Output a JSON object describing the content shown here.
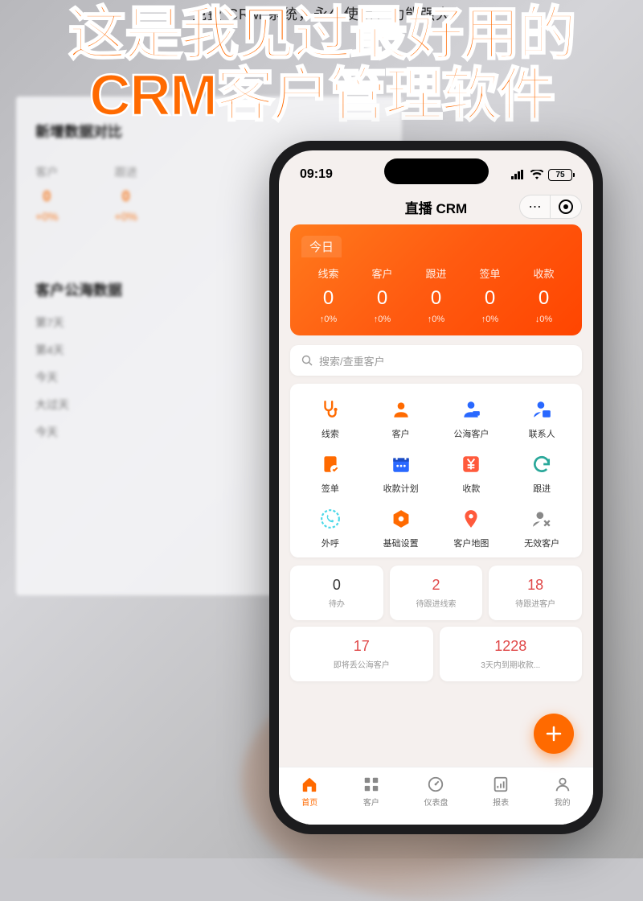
{
  "top_banner": "免费 CRM 系统，永久使用，功能强大",
  "headline_line1": "这是我见过最好用的",
  "headline_line2": "CRM客户管理软件",
  "laptop": {
    "section1_title": "新增数据对比",
    "items": [
      {
        "label": "客户",
        "value": "0",
        "pct": "+0%"
      },
      {
        "label": "跟进",
        "value": "0",
        "pct": "+0%"
      }
    ],
    "section2_title": "客户公海数据",
    "list": [
      "第7天",
      "第4天",
      "今天",
      "大过天",
      "今天"
    ]
  },
  "phone": {
    "status": {
      "time": "09:19",
      "battery": "75"
    },
    "app_title": "直播 CRM",
    "dashboard": {
      "today_label": "今日",
      "metrics": [
        {
          "label": "线索",
          "value": "0",
          "change": "↑0%"
        },
        {
          "label": "客户",
          "value": "0",
          "change": "↑0%"
        },
        {
          "label": "跟进",
          "value": "0",
          "change": "↑0%"
        },
        {
          "label": "签单",
          "value": "0",
          "change": "↑0%"
        },
        {
          "label": "收款",
          "value": "0",
          "change": "↓0%"
        }
      ]
    },
    "search_placeholder": "搜索/查重客户",
    "grid": [
      [
        {
          "label": "线索",
          "icon": "stethoscope",
          "color": "#ff6a00"
        },
        {
          "label": "客户",
          "icon": "person",
          "color": "#ff6a00"
        },
        {
          "label": "公海客户",
          "icon": "person-blue",
          "color": "#2968ff"
        },
        {
          "label": "联系人",
          "icon": "person-card",
          "color": "#2968ff"
        }
      ],
      [
        {
          "label": "签单",
          "icon": "clipboard",
          "color": "#ff6a00"
        },
        {
          "label": "收款计划",
          "icon": "calendar",
          "color": "#2968ff"
        },
        {
          "label": "收款",
          "icon": "yen",
          "color": "#ff5a3c"
        },
        {
          "label": "跟进",
          "icon": "refresh",
          "color": "#2aa89a"
        }
      ],
      [
        {
          "label": "外呼",
          "icon": "phone-out",
          "color": "#4ad8e8"
        },
        {
          "label": "基础设置",
          "icon": "hexagon",
          "color": "#ff6a00"
        },
        {
          "label": "客户地图",
          "icon": "location",
          "color": "#ff5a3c"
        },
        {
          "label": "无效客户",
          "icon": "person-x",
          "color": "#888"
        }
      ]
    ],
    "stats_row1": [
      {
        "value": "0",
        "label": "待办",
        "color": "dark"
      },
      {
        "value": "2",
        "label": "待跟进线索",
        "color": "red"
      },
      {
        "value": "18",
        "label": "待跟进客户",
        "color": "red"
      }
    ],
    "stats_row2": [
      {
        "value": "17",
        "label": "即将丢公海客户",
        "color": "red"
      },
      {
        "value": "1228",
        "label": "3天内到期收款...",
        "color": "red"
      }
    ],
    "bottom_nav": [
      {
        "label": "首页",
        "icon": "home",
        "active": true
      },
      {
        "label": "客户",
        "icon": "apps",
        "active": false
      },
      {
        "label": "仪表盘",
        "icon": "dashboard",
        "active": false
      },
      {
        "label": "报表",
        "icon": "report",
        "active": false
      },
      {
        "label": "我的",
        "icon": "user",
        "active": false
      }
    ]
  }
}
